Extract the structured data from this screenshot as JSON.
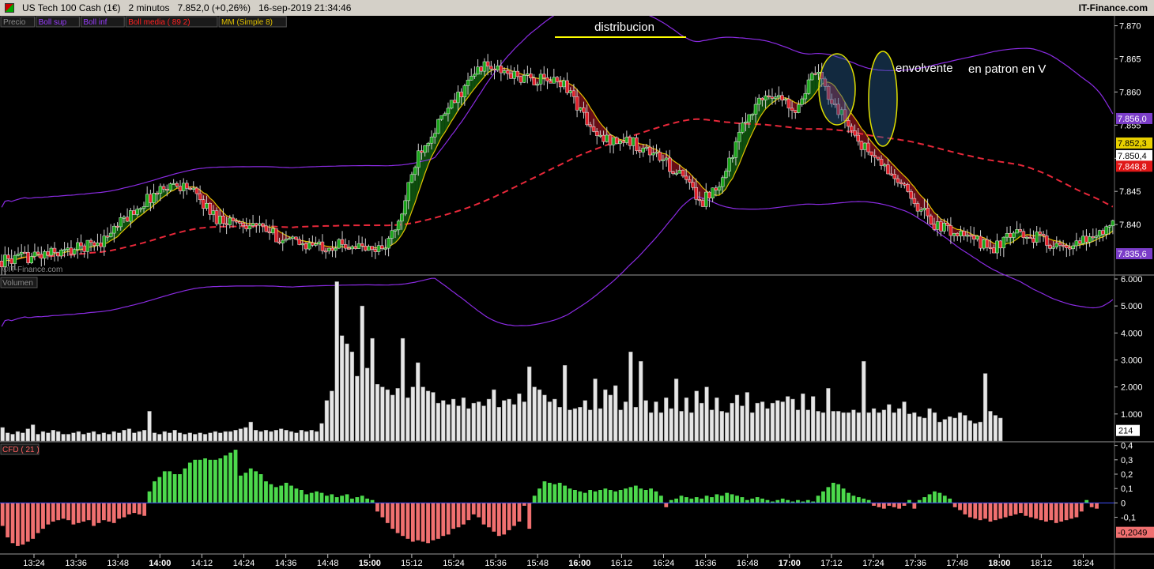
{
  "header": {
    "instrument": "US Tech 100 Cash (1€)",
    "timeframe": "2 minutos",
    "last_price": "7.852,0 (+0,26%)",
    "datetime": "16-sep-2019 21:34:46",
    "brand": "IT-Finance.com"
  },
  "legend": [
    {
      "label": "Precio",
      "color": "#8a8a8a"
    },
    {
      "label": "Boll sup",
      "color": "#9a3cff"
    },
    {
      "label": "Boll inf",
      "color": "#9a3cff"
    },
    {
      "label": "Boll media ( 89 2)",
      "color": "#ff2020"
    },
    {
      "label": "MM (Simple 8)",
      "color": "#e0c000"
    }
  ],
  "watermark": "©IT-Finance.com",
  "colors": {
    "up": "#19a519",
    "down": "#e0202a",
    "background": "#000000"
  },
  "price_panel": {
    "ticks": [
      "7.870",
      "7.865",
      "7.860",
      "7.855",
      "7.850",
      "7.845",
      "7.840"
    ],
    "ylim": [
      7832.5,
      7871.5
    ],
    "badges": [
      {
        "text": "7.856,0",
        "value": 7856.0,
        "bg": "#7b3dc8",
        "fg": "#ffffff"
      },
      {
        "text": "7.852,3",
        "value": 7852.3,
        "bg": "#e8d000",
        "fg": "#000000"
      },
      {
        "text": "7.850,4",
        "value": 7850.4,
        "bg": "#ffffff",
        "fg": "#000000"
      },
      {
        "text": "7.848,8",
        "value": 7848.8,
        "bg": "#e01818",
        "fg": "#ffffff"
      },
      {
        "text": "7.835,6",
        "value": 7835.6,
        "bg": "#7b3dc8",
        "fg": "#ffffff"
      }
    ],
    "annotations": {
      "distribucion": "distribucion",
      "envolvente": "envolvente",
      "patron": "en patron en V"
    }
  },
  "volume_panel": {
    "label": "Volumen",
    "ticks": [
      "6.000",
      "5.000",
      "4.000",
      "3.000",
      "2.000",
      "1.000"
    ],
    "ylim": [
      0,
      6000
    ],
    "badge": "214",
    "values": [
      500,
      300,
      250,
      350,
      300,
      450,
      600,
      250,
      350,
      300,
      400,
      350,
      250,
      250,
      300,
      350,
      250,
      300,
      350,
      250,
      300,
      250,
      350,
      300,
      400,
      450,
      300,
      350,
      400,
      1100,
      300,
      250,
      350,
      300,
      400,
      300,
      250,
      300,
      250,
      300,
      250,
      300,
      350,
      300,
      350,
      350,
      400,
      450,
      500,
      700,
      400,
      350,
      400,
      350,
      400,
      450,
      400,
      350,
      300,
      400,
      350,
      400,
      350,
      650,
      1500,
      1850,
      5900,
      3900,
      3600,
      3300,
      2400,
      5000,
      2700,
      3800,
      2100,
      2000,
      1900,
      1700,
      1950,
      3800,
      1600,
      2000,
      2900,
      2000,
      1850,
      1800,
      1400,
      1500,
      1350,
      1550,
      1300,
      1600,
      1200,
      1400,
      1450,
      1300,
      1550,
      1900,
      1250,
      1500,
      1550,
      1350,
      1750,
      1450,
      2750,
      2000,
      1900,
      1700,
      1450,
      1550,
      1250,
      2800,
      1150,
      1200,
      1250,
      1500,
      1150,
      2300,
      1200,
      1900,
      1700,
      2050,
      1150,
      1450,
      3300,
      1250,
      2950,
      1500,
      1050,
      1450,
      1050,
      1600,
      1200,
      2300,
      1100,
      1600,
      1050,
      1850,
      1400,
      2000,
      1150,
      1600,
      1100,
      1050,
      1400,
      1700,
      1300,
      1800,
      1050,
      1400,
      1450,
      1200,
      1400,
      1500,
      1450,
      1650,
      1550,
      1150,
      1750,
      1150,
      1650,
      1100,
      1050,
      1950,
      1100,
      1100,
      1050,
      1050,
      1150,
      1050,
      2950,
      1050,
      1200,
      1050,
      1150,
      1350,
      1050,
      1200,
      1450,
      1000,
      1050,
      900,
      850,
      1200,
      1050,
      700,
      800,
      900,
      850,
      1050,
      950,
      750,
      650,
      700,
      2500,
      1100,
      950,
      850
    ]
  },
  "cfd_panel": {
    "label": "CFD ( 21 )",
    "ticks": [
      "0,4",
      "0,3",
      "0,2",
      "0,1",
      "0",
      "-0,1"
    ],
    "ylim": [
      -0.35,
      0.42
    ],
    "badge": "-0,2049",
    "values": [
      -0.16,
      -0.24,
      -0.28,
      -0.3,
      -0.29,
      -0.27,
      -0.25,
      -0.21,
      -0.18,
      -0.15,
      -0.13,
      -0.12,
      -0.11,
      -0.12,
      -0.15,
      -0.14,
      -0.13,
      -0.12,
      -0.16,
      -0.14,
      -0.12,
      -0.13,
      -0.14,
      -0.11,
      -0.1,
      -0.08,
      -0.07,
      -0.08,
      -0.09,
      0.08,
      0.15,
      0.18,
      0.22,
      0.22,
      0.2,
      0.2,
      0.24,
      0.28,
      0.3,
      0.3,
      0.31,
      0.3,
      0.3,
      0.31,
      0.33,
      0.35,
      0.37,
      0.19,
      0.21,
      0.24,
      0.22,
      0.2,
      0.15,
      0.13,
      0.11,
      0.12,
      0.14,
      0.12,
      0.1,
      0.09,
      0.06,
      0.07,
      0.08,
      0.07,
      0.05,
      0.06,
      0.04,
      0.05,
      0.06,
      0.03,
      0.04,
      0.05,
      0.03,
      0.02,
      -0.06,
      -0.1,
      -0.14,
      -0.18,
      -0.21,
      -0.23,
      -0.25,
      -0.27,
      -0.26,
      -0.27,
      -0.28,
      -0.26,
      -0.25,
      -0.23,
      -0.22,
      -0.18,
      -0.17,
      -0.15,
      -0.12,
      -0.08,
      -0.1,
      -0.15,
      -0.17,
      -0.2,
      -0.23,
      -0.22,
      -0.19,
      -0.16,
      -0.13,
      -0.02,
      -0.18,
      0.05,
      0.1,
      0.15,
      0.14,
      0.13,
      0.14,
      0.12,
      0.1,
      0.09,
      0.08,
      0.07,
      0.09,
      0.08,
      0.09,
      0.1,
      0.09,
      0.08,
      0.09,
      0.1,
      0.11,
      0.12,
      0.1,
      0.09,
      0.1,
      0.08,
      0.05,
      -0.03,
      0.02,
      0.03,
      0.05,
      0.04,
      0.03,
      0.04,
      0.03,
      0.05,
      0.04,
      0.06,
      0.05,
      0.07,
      0.06,
      0.05,
      0.04,
      0.02,
      0.03,
      0.04,
      0.03,
      0.02,
      0.01,
      0.02,
      0.03,
      0.02,
      0.01,
      0.02,
      0.01,
      0.02,
      0.01,
      0.05,
      0.08,
      0.11,
      0.14,
      0.13,
      0.1,
      0.07,
      0.05,
      0.04,
      0.03,
      0.02,
      -0.02,
      -0.03,
      -0.04,
      -0.02,
      -0.03,
      -0.04,
      -0.02,
      0.02,
      -0.04,
      0.02,
      0.04,
      0.06,
      0.08,
      0.07,
      0.05,
      0.03,
      -0.03,
      -0.05,
      -0.08,
      -0.1,
      -0.11,
      -0.12,
      -0.11,
      -0.13,
      -0.12,
      -0.11,
      -0.1,
      -0.09,
      -0.08,
      -0.07,
      -0.09,
      -0.1,
      -0.11,
      -0.12,
      -0.13,
      -0.12,
      -0.14,
      -0.13,
      -0.12,
      -0.11,
      -0.1,
      -0.06,
      0.02,
      -0.03,
      -0.04
    ]
  },
  "time_axis": [
    "13:24",
    "13:36",
    "13:48",
    "14:00",
    "14:12",
    "14:24",
    "14:36",
    "14:48",
    "15:00",
    "15:12",
    "15:24",
    "15:36",
    "15:48",
    "16:00",
    "16:12",
    "16:24",
    "16:36",
    "16:48",
    "17:00",
    "17:12",
    "17:24",
    "17:36",
    "17:48",
    "18:00",
    "18:12",
    "18:24"
  ],
  "time_axis_bold": [
    "14:00",
    "15:00",
    "16:00",
    "17:00",
    "18:00"
  ]
}
